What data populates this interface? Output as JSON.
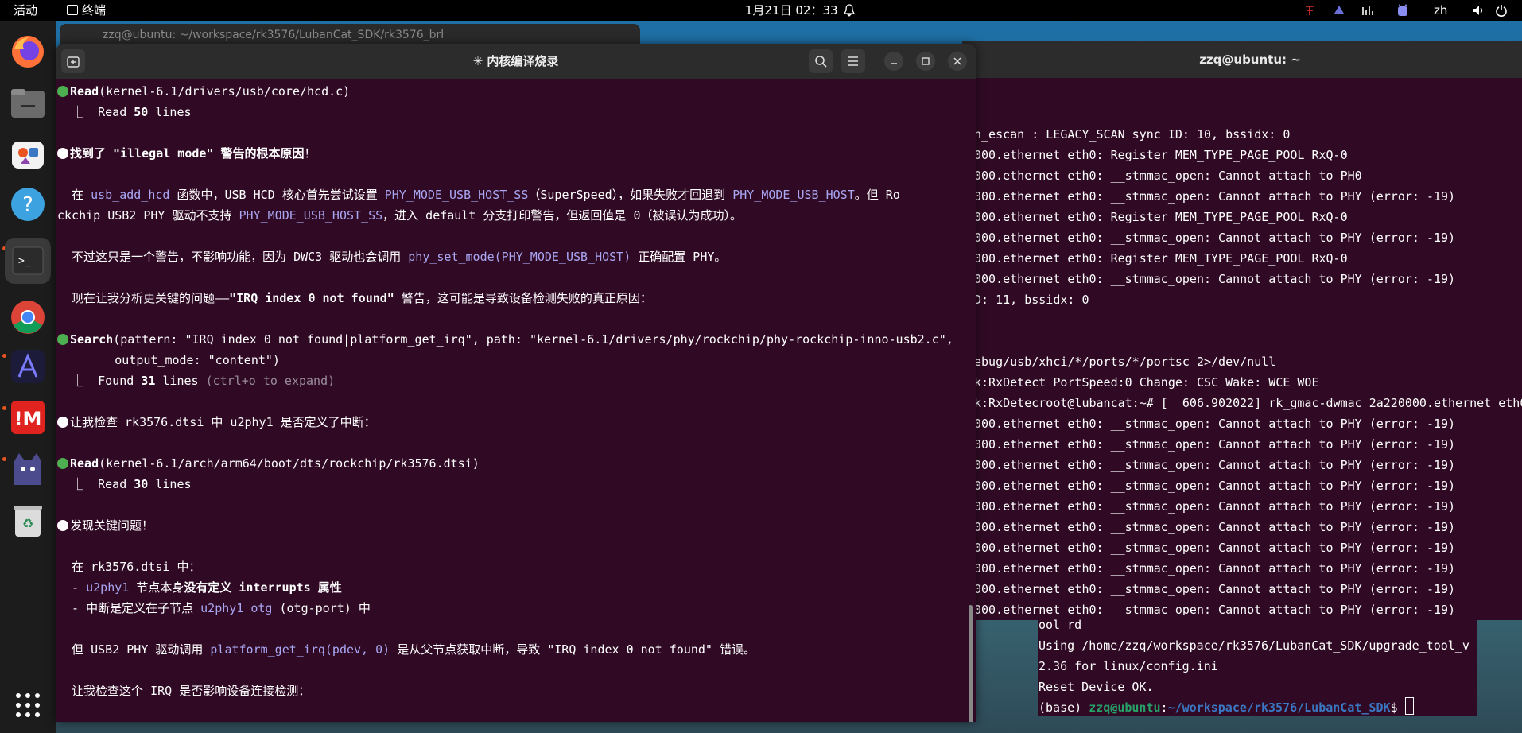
{
  "topbar": {
    "activities": "活动",
    "app_name": "终端",
    "clock": "1月21日 02：33",
    "lang": "zh"
  },
  "dock": {
    "items": [
      "firefox-icon",
      "files-icon",
      "app-center-icon",
      "help-icon",
      "terminal-icon",
      "chrome-icon",
      "ai-app-icon",
      "tool-app-icon",
      "cat-app-icon",
      "trash-icon",
      "show-apps-icon"
    ]
  },
  "back_window": {
    "title": "zzq@ubuntu: ~/workspace/rk3576/LubanCat_SDK/rk3576_brl"
  },
  "right_window": {
    "title": "zzq@ubuntu: ~",
    "lines": [
      "n_escan : LEGACY_SCAN sync ID: 10, bssidx: 0",
      "000.ethernet eth0: Register MEM_TYPE_PAGE_POOL RxQ-0",
      "000.ethernet eth0: __stmmac_open: Cannot attach to PH0",
      "000.ethernet eth0: __stmmac_open: Cannot attach to PHY (error: -19)",
      "000.ethernet eth0: Register MEM_TYPE_PAGE_POOL RxQ-0",
      "000.ethernet eth0: __stmmac_open: Cannot attach to PHY (error: -19)",
      "000.ethernet eth0: Register MEM_TYPE_PAGE_POOL RxQ-0",
      "000.ethernet eth0: __stmmac_open: Cannot attach to PHY (error: -19)",
      "D: 11, bssidx: 0",
      "",
      "",
      "ebug/usb/xhci/*/ports/*/portsc 2>/dev/null",
      "k:RxDetect PortSpeed:0 Change: CSC Wake: WCE WOE",
      "k:RxDetecroot@lubancat:~# [  606.902022] rk_gmac-dwmac 2a220000.ethernet eth0",
      "000.ethernet eth0: __stmmac_open: Cannot attach to PHY (error: -19)",
      "000.ethernet eth0: __stmmac_open: Cannot attach to PHY (error: -19)",
      "000.ethernet eth0: __stmmac_open: Cannot attach to PHY (error: -19)",
      "000.ethernet eth0: __stmmac_open: Cannot attach to PHY (error: -19)",
      "000.ethernet eth0: __stmmac_open: Cannot attach to PHY (error: -19)",
      "000.ethernet eth0: __stmmac_open: Cannot attach to PHY (error: -19)",
      "000.ethernet eth0: __stmmac_open: Cannot attach to PHY (error: -19)",
      "000.ethernet eth0: __stmmac_open: Cannot attach to PHY (error: -19)",
      "000.ethernet eth0: __stmmac_open: Cannot attach to PHY (error: -19)",
      "000.ethernet eth0: __stmmac_open: Cannot attach to PHY (error: -19)",
      "000.ethernet eth0: __stmmac_open: Cannot attach to PHY (error:"
    ]
  },
  "bottom_window": {
    "lines": [
      "ool rd",
      "Using /home/zzq/workspace/rk3576/LubanCat_SDK/upgrade_tool_v",
      "2.36_for_linux/config.ini",
      "Reset Device OK."
    ],
    "prompt_env": "(base) ",
    "prompt_user": "zzq@ubuntu",
    "prompt_colon": ":",
    "prompt_path": "~/workspace/rk3576/LubanCat_SDK",
    "prompt_end": "$ "
  },
  "main_window": {
    "title": "✳ 内核编译烧录",
    "content": {
      "l1_tool": "Read",
      "l1_arg": "(kernel-6.1/drivers/usb/core/hcd.c)",
      "l2_prefix": "  ⎿  Read ",
      "l2_num": "50",
      "l2_suffix": " lines",
      "l3_a": "找到了 ",
      "l3_b": "\"illegal mode\"",
      "l3_c": " 警告的根本原因",
      "l3_d": "！",
      "p1_a": "  在 ",
      "p1_b": "usb_add_hcd",
      "p1_c": " 函数中，USB HCD 核心首先尝试设置 ",
      "p1_d": "PHY_MODE_USB_HOST_SS",
      "p1_e": "（SuperSpeed），如果失败才回退到 ",
      "p1_f": "PHY_MODE_USB_HOST",
      "p1_g": "。但 Ro",
      "p2_a": "ckchip USB2 PHY 驱动不支持 ",
      "p2_b": "PHY_MODE_USB_HOST_SS",
      "p2_c": "，进入 default 分支打印警告，但返回值是 0（被误认为成功）。",
      "p3_a": "  不过这只是一个警告，不影响功能，因为 DWC3 驱动也会调用 ",
      "p3_b": "phy_set_mode(PHY_MODE_USB_HOST)",
      "p3_c": " 正确配置 PHY。",
      "p4_a": "  现在让我分析更关键的问题——",
      "p4_b": "\"IRQ index 0 not found\"",
      "p4_c": " 警告，这可能是导致设备检测失败的真正原因：",
      "s1_tool": "Search",
      "s1_arg": "(pattern: \"IRQ index 0 not found|platform_get_irq\", path: \"kernel-6.1/drivers/phy/rockchip/phy-rockchip-inno-usb2.c\",",
      "s2": "        output_mode: \"content\")",
      "s3_prefix": "  ⎿  Found ",
      "s3_num": "31",
      "s3_mid": " lines ",
      "s3_hint": "(ctrl+o to expand)",
      "c1": "让我检查 rk3576.dtsi 中 u2phy1 是否定义了中断：",
      "r2_tool": "Read",
      "r2_arg": "(kernel-6.1/arch/arm64/boot/dts/rockchip/rk3576.dtsi)",
      "r3_prefix": "  ⎿  Read ",
      "r3_num": "30",
      "r3_suffix": " lines",
      "f1": "发现关键问题！",
      "f2": "  在 rk3576.dtsi 中：",
      "f3_a": "  - ",
      "f3_b": "u2phy1",
      "f3_c": " 节点本身",
      "f3_d": "没有定义 interrupts 属性",
      "f4_a": "  - 中断是定义在子节点 ",
      "f4_b": "u2phy1_otg",
      "f4_c": " (otg-port) 中",
      "f5_a": "  但 USB2 PHY 驱动调用 ",
      "f5_b": "platform_get_irq(pdev, 0)",
      "f5_c": " 是从父节点获取中断，导致 \"IRQ index 0 not found\" 错误。",
      "f6": "  让我检查这个 IRQ 是否影响设备连接检测："
    }
  }
}
